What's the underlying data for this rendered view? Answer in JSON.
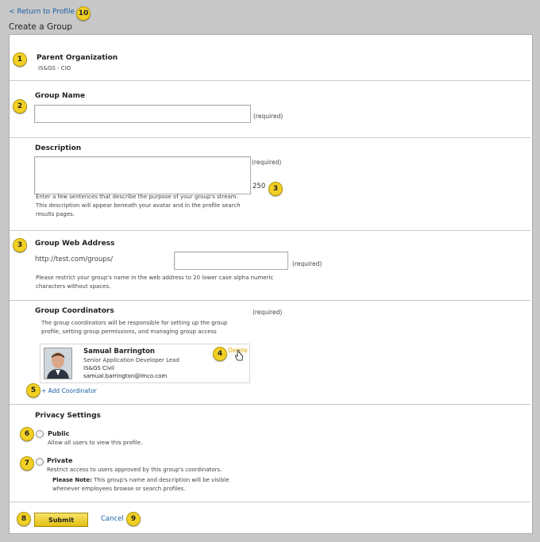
{
  "nav": {
    "return_link": "< Return to Profile",
    "return_badge": "10"
  },
  "page": {
    "title": "Create a Group"
  },
  "parent_org": {
    "badge": "1",
    "label": "Parent Organization",
    "value": "IS&GS - CIO"
  },
  "group_name": {
    "badge": "2",
    "label": "Group Name",
    "value": "",
    "required": "(required)"
  },
  "description": {
    "label": "Description",
    "value": "",
    "required": "(required)",
    "char_count": "250",
    "count_badge": "3",
    "help": "Enter a few sentences that describe the purpose of your group's stream. This description will appear beneath your avatar and in the profile search results pages."
  },
  "web_address": {
    "badge": "3",
    "label": "Group Web Address",
    "prefix": "http://test.com/groups/",
    "value": "",
    "required": "(required)",
    "help": "Please restrict your group's name in the web address to 20 lower case alpha numeric characters without spaces."
  },
  "coordinators": {
    "label": "Group Coordinators",
    "required": "(required)",
    "help": "The group coordinators will be responsible for setting up the group profile, setting group permissions, and managing group access",
    "person": {
      "name": "Samual Barrington",
      "title": "Senior Application Developer Lead",
      "org": "IS&GS Civil",
      "email": "samual.barrington@lmco.com"
    },
    "delete_label": "Delete",
    "delete_badge": "4",
    "add_badge": "5",
    "add_label": "+ Add Coordinator"
  },
  "privacy": {
    "label": "Privacy Settings",
    "public": {
      "badge": "6",
      "label": "Public",
      "desc": "Allow  all users to view this profile."
    },
    "private": {
      "badge": "7",
      "label": "Private",
      "desc": "Restrict access to users approved by this group's coordinators.",
      "note_label": "Please Note:",
      "note_text": " This group's name and description will be visible whenever employees browse or search profiles."
    }
  },
  "actions": {
    "submit_badge": "8",
    "submit_label": "Submit",
    "cancel_label": "Cancel",
    "cancel_badge": "9"
  },
  "colors": {
    "badge": "#f2d024",
    "link": "#1a5fa8",
    "delete_link": "#e0a800",
    "background": "#c8c8c8"
  }
}
